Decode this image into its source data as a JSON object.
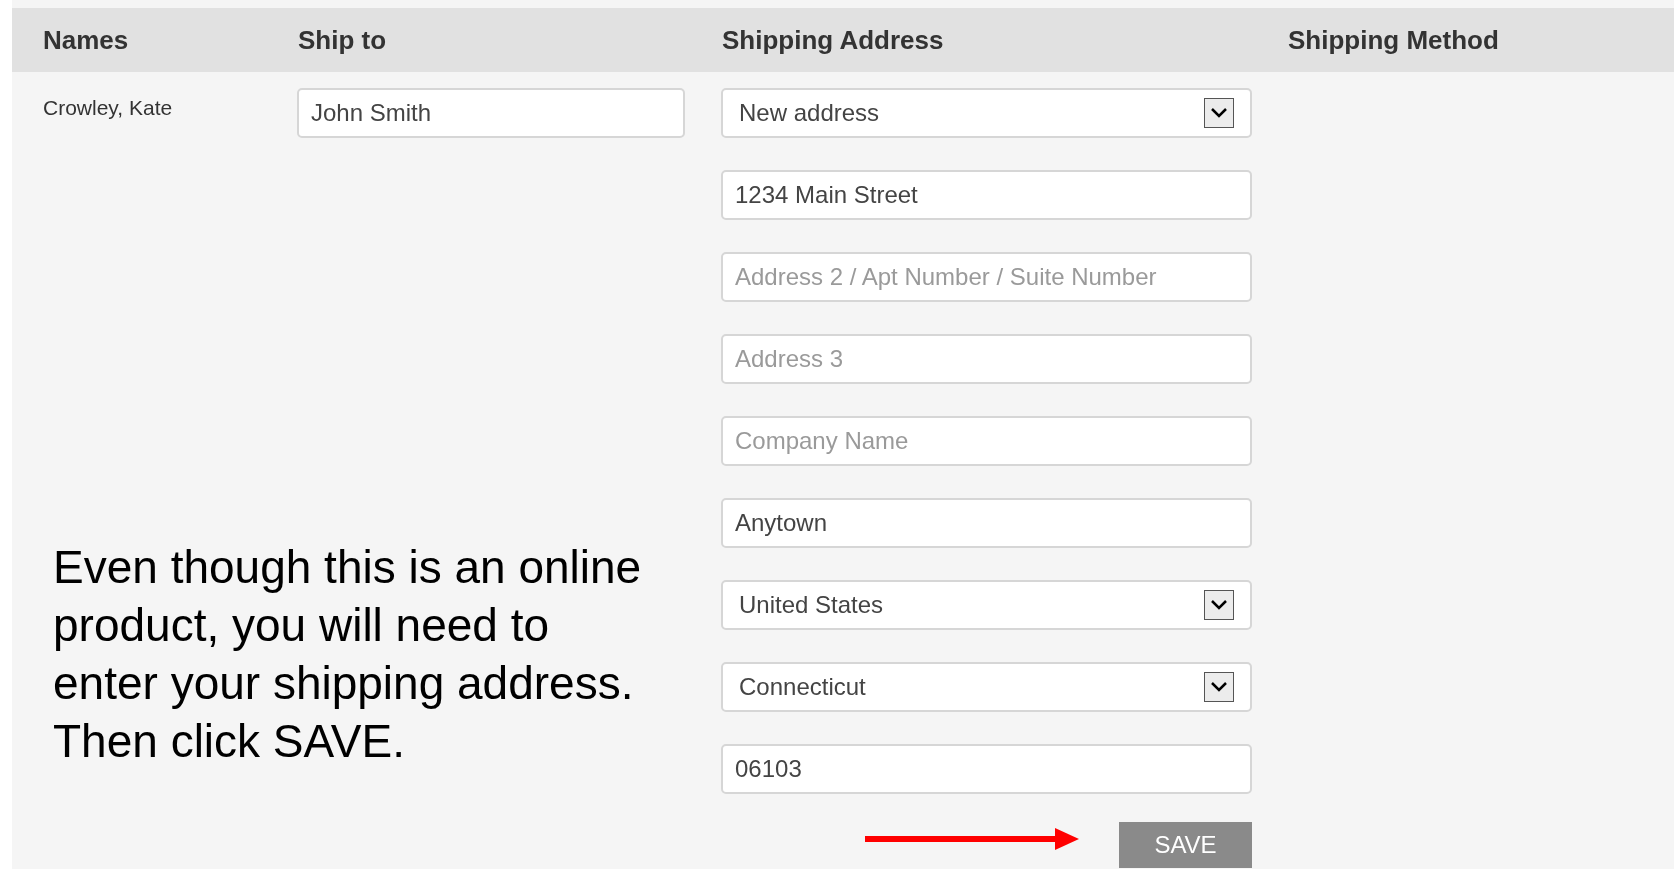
{
  "table": {
    "columns": [
      "Names",
      "Ship to",
      "Shipping Address",
      "Shipping Method"
    ],
    "rows": [
      {
        "name": "Crowley, Kate",
        "ship_to": {
          "value": "John Smith"
        },
        "address_fields": [
          {
            "kind": "select",
            "value": "New address"
          },
          {
            "kind": "input",
            "value": "1234 Main Street"
          },
          {
            "kind": "input",
            "placeholder": "Address 2 / Apt Number / Suite Number"
          },
          {
            "kind": "input",
            "placeholder": "Address 3"
          },
          {
            "kind": "input",
            "placeholder": "Company Name"
          },
          {
            "kind": "input",
            "value": "Anytown"
          },
          {
            "kind": "select",
            "value": "United States"
          },
          {
            "kind": "select",
            "value": "Connecticut"
          },
          {
            "kind": "input",
            "value": "06103"
          }
        ]
      }
    ]
  },
  "save_button": "SAVE",
  "note": "Even though this is an online product, you will need to enter your shipping address. Then click SAVE."
}
